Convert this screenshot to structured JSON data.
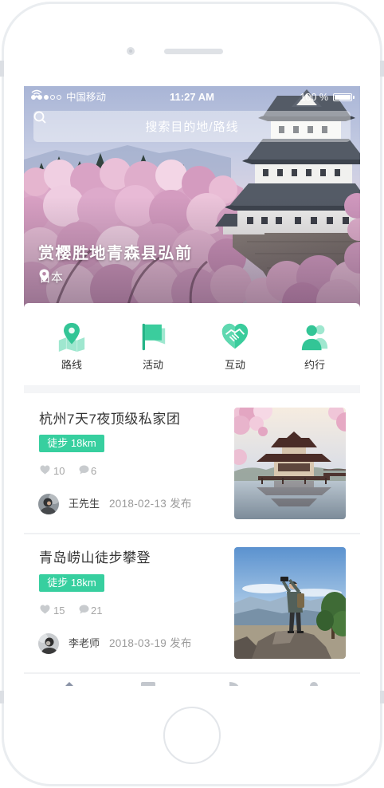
{
  "status_bar": {
    "signal_filled": 3,
    "signal_total": 5,
    "carrier": "中国移动",
    "time": "11:27 AM",
    "battery_text": "100 %",
    "battery_level": 1
  },
  "search": {
    "placeholder": "搜索目的地/路线",
    "icon": "search-icon"
  },
  "hero": {
    "title": "赏樱胜地青森县弘前",
    "location": "日本",
    "location_icon": "map-pin-icon"
  },
  "categories": [
    {
      "label": "路线",
      "icon": "map-route-icon"
    },
    {
      "label": "活动",
      "icon": "flag-icon"
    },
    {
      "label": "互动",
      "icon": "handshake-heart-icon"
    },
    {
      "label": "约行",
      "icon": "people-icon"
    }
  ],
  "posts": [
    {
      "title": "杭州7天7夜顶级私家团",
      "tag": "徒步 18km",
      "likes": "10",
      "comments": "6",
      "author": "王先生",
      "date": "2018-02-13 发布"
    },
    {
      "title": "青岛崂山徒步攀登",
      "tag": "徒步 18km",
      "likes": "15",
      "comments": "21",
      "author": "李老师",
      "date": "2018-03-19 发布"
    }
  ],
  "tab_bar": {
    "icons": [
      "home-icon",
      "list-icon",
      "message-icon",
      "profile-icon"
    ]
  },
  "colors": {
    "accent": "#35c99b",
    "accent_dark": "#25b488",
    "accent_light": "#9fe7cf",
    "tag_bg": "#37cf9f",
    "text_primary": "#333333",
    "text_secondary": "#9b9b9b",
    "divider": "#f2f3f5"
  }
}
